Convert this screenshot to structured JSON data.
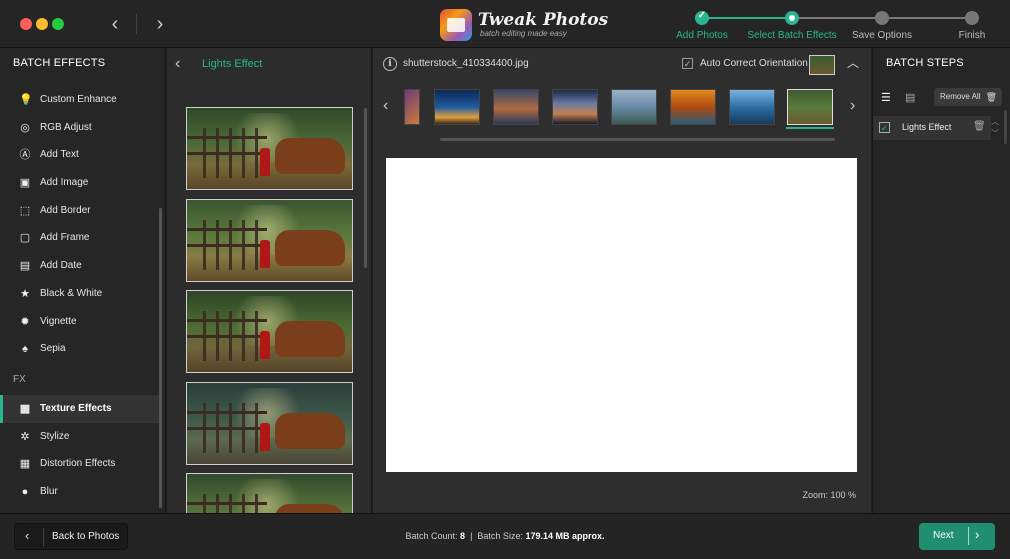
{
  "app": {
    "logo_title": "Tweak Photos",
    "logo_subtitle": "batch editing made easy"
  },
  "steps": [
    {
      "label": "Add Photos",
      "state": "done"
    },
    {
      "label": "Select Batch Effects",
      "state": "current"
    },
    {
      "label": "Save Options",
      "state": "todo"
    },
    {
      "label": "Finish",
      "state": "todo"
    }
  ],
  "colors": {
    "accent": "#2bb58f",
    "todo": "#777777"
  },
  "left_panel": {
    "title": "BATCH EFFECTS",
    "effects": [
      {
        "label": "Custom Enhance",
        "icon": "bulb-icon",
        "glyph": "💡"
      },
      {
        "label": "RGB Adjust",
        "icon": "rgb-icon",
        "glyph": "◎"
      },
      {
        "label": "Add Text",
        "icon": "text-icon",
        "glyph": "Ⓐ"
      },
      {
        "label": "Add Image",
        "icon": "image-icon",
        "glyph": "▣"
      },
      {
        "label": "Add Border",
        "icon": "border-icon",
        "glyph": "⬚"
      },
      {
        "label": "Add Frame",
        "icon": "frame-icon",
        "glyph": "▢"
      },
      {
        "label": "Add Date",
        "icon": "calendar-icon",
        "glyph": "▤"
      },
      {
        "label": "Black & White",
        "icon": "star-icon",
        "glyph": "★"
      },
      {
        "label": "Vignette",
        "icon": "gear-icon",
        "glyph": "✹"
      },
      {
        "label": "Sepia",
        "icon": "mushroom-icon",
        "glyph": "♠"
      }
    ],
    "fx_label": "FX",
    "fx_effects": [
      {
        "label": "Texture Effects",
        "icon": "texture-icon",
        "glyph": "▩",
        "active": true
      },
      {
        "label": "Stylize",
        "icon": "stylize-icon",
        "glyph": "✲"
      },
      {
        "label": "Distortion Effects",
        "icon": "grid-icon",
        "glyph": "▦"
      },
      {
        "label": "Blur",
        "icon": "drop-icon",
        "glyph": "●"
      }
    ]
  },
  "thumb_panel": {
    "title": "Lights Effect",
    "count": 5
  },
  "center": {
    "file_name": "shutterstock_410334400.jpg",
    "auto_correct_label": "Auto Correct Orientation",
    "auto_correct_checked": true,
    "zoom_label": "Zoom: 100 %"
  },
  "right_panel": {
    "title": "BATCH STEPS",
    "remove_all_label": "Remove  All",
    "steps": [
      {
        "label": "Lights Effect",
        "checked": true
      }
    ]
  },
  "bottom": {
    "back_label": "Back to Photos",
    "batch_count_label": "Batch Count:",
    "batch_count": "8",
    "batch_size_label": "Batch Size:",
    "batch_size": "179.14 MB approx.",
    "next_label": "Next"
  }
}
